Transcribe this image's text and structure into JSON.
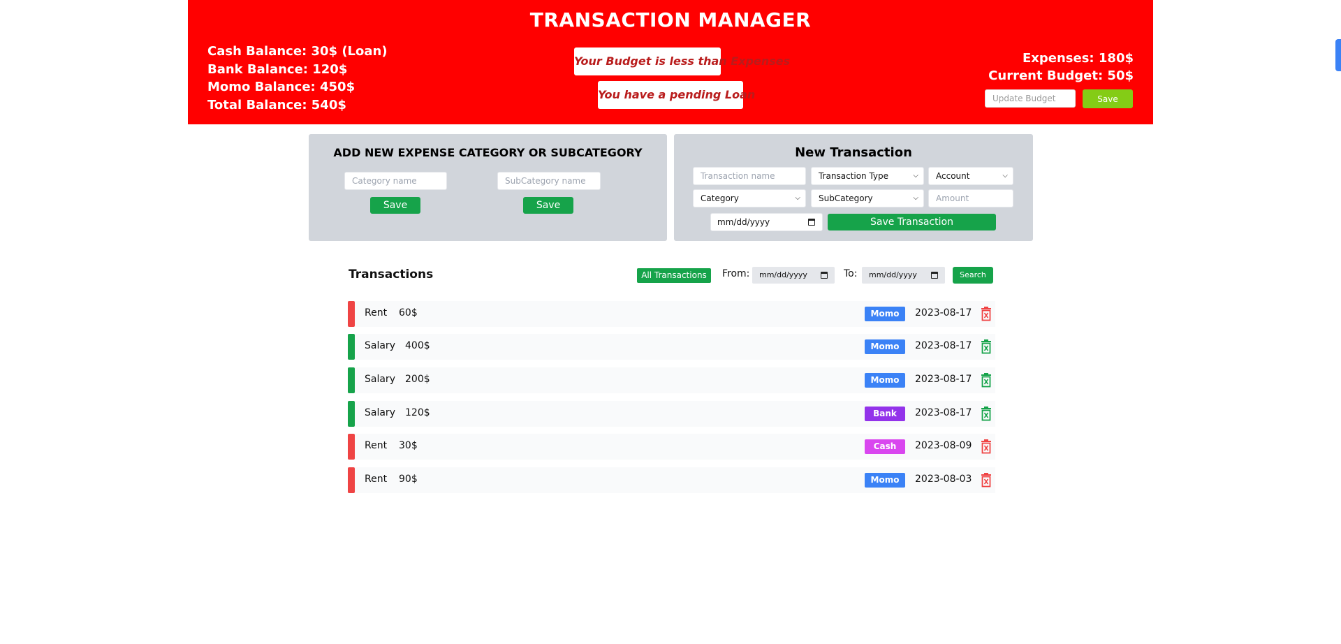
{
  "header": {
    "title": "TRANSACTION MANAGER",
    "balances": {
      "cash": "Cash Balance: 30$ (Loan)",
      "bank": "Bank Balance: 120$",
      "momo": "Momo Balance: 450$",
      "total": "Total Balance: 540$"
    },
    "alerts": {
      "budget": "Your Budget is less than Expenses",
      "loan": "You have a pending Loan"
    },
    "expenses": "Expenses: 180$",
    "current_budget": "Current Budget: 50$",
    "budget_placeholder": "Update Budget",
    "save_label": "Save"
  },
  "category_panel": {
    "title": "ADD NEW EXPENSE CATEGORY OR SUBCATEGORY",
    "category_placeholder": "Category name",
    "subcategory_placeholder": "SubCategory name",
    "save_category_label": "Save",
    "save_subcategory_label": "Save"
  },
  "transaction_panel": {
    "title": "New Transaction",
    "name_placeholder": "Transaction name",
    "type_select": "Transaction Type",
    "account_select": "Account",
    "category_select": "Category",
    "subcategory_select": "SubCategory",
    "amount_placeholder": "Amount",
    "date_value": "mm/dd/yyyy",
    "save_label": "Save Transaction"
  },
  "transactions": {
    "title": "Transactions",
    "all_label": "All Transactions",
    "from_label": "From:",
    "to_label": "To:",
    "from_value": "mm/dd/yyyy",
    "to_value": "mm/dd/yyyy",
    "search_label": "Search",
    "items": [
      {
        "name": "Rent",
        "amount": "60$",
        "account": "Momo",
        "date": "2023-08-17",
        "kind": "expense"
      },
      {
        "name": "Salary",
        "amount": "400$",
        "account": "Momo",
        "date": "2023-08-17",
        "kind": "income"
      },
      {
        "name": "Salary",
        "amount": "200$",
        "account": "Momo",
        "date": "2023-08-17",
        "kind": "income"
      },
      {
        "name": "Salary",
        "amount": "120$",
        "account": "Bank",
        "date": "2023-08-17",
        "kind": "income"
      },
      {
        "name": "Rent",
        "amount": "30$",
        "account": "Cash",
        "date": "2023-08-09",
        "kind": "expense"
      },
      {
        "name": "Rent",
        "amount": "90$",
        "account": "Momo",
        "date": "2023-08-03",
        "kind": "expense"
      }
    ]
  },
  "colors": {
    "header_bg": "#ff0000",
    "expense": "#ef4444",
    "income": "#16a34a",
    "momo": "#3b82f6",
    "bank": "#9333ea",
    "cash": "#d946ef",
    "budget_save": "#84cc16"
  },
  "icons": {
    "delete": "trash-icon",
    "date": "calendar-icon",
    "select": "chevron-down-icon"
  }
}
